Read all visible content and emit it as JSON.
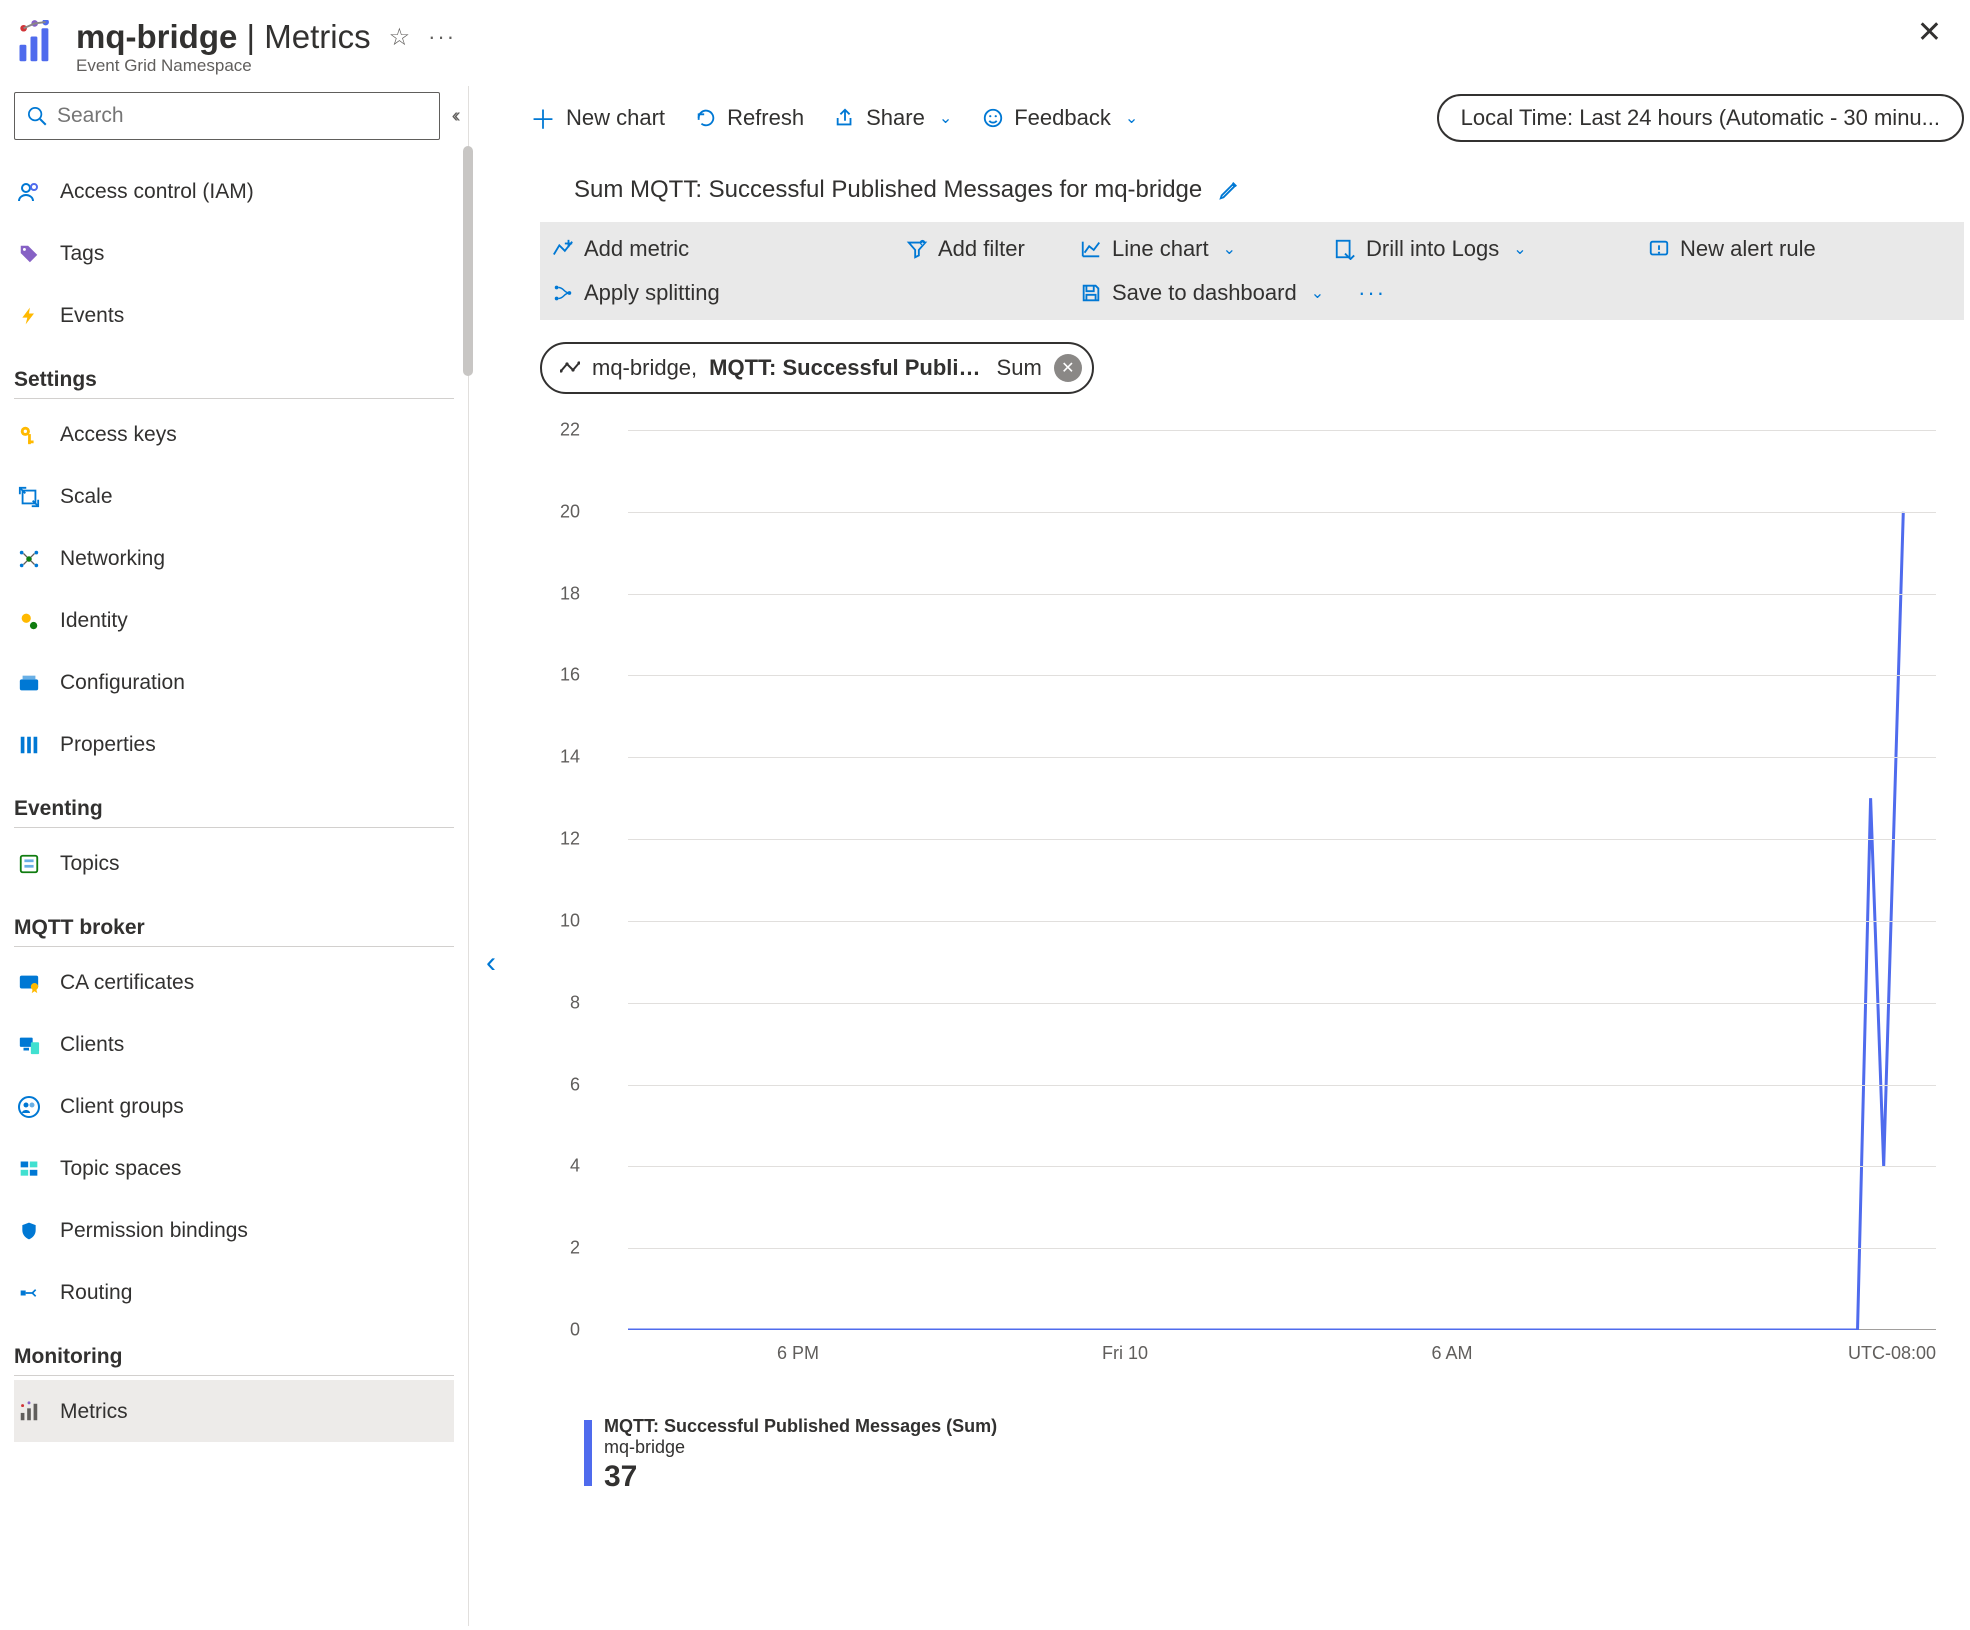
{
  "header": {
    "resource_name": "mq-bridge",
    "section": "Metrics",
    "subtitle": "Event Grid Namespace"
  },
  "sidebar": {
    "search_placeholder": "Search",
    "items_top": [
      {
        "icon": "people",
        "label": "Access control (IAM)"
      },
      {
        "icon": "tag",
        "label": "Tags"
      },
      {
        "icon": "bolt",
        "label": "Events"
      }
    ],
    "sections": [
      {
        "title": "Settings",
        "items": [
          {
            "icon": "key",
            "label": "Access keys"
          },
          {
            "icon": "scale",
            "label": "Scale"
          },
          {
            "icon": "network",
            "label": "Networking"
          },
          {
            "icon": "identity",
            "label": "Identity"
          },
          {
            "icon": "config",
            "label": "Configuration"
          },
          {
            "icon": "properties",
            "label": "Properties"
          }
        ]
      },
      {
        "title": "Eventing",
        "items": [
          {
            "icon": "topics",
            "label": "Topics"
          }
        ]
      },
      {
        "title": "MQTT broker",
        "items": [
          {
            "icon": "cert",
            "label": "CA certificates"
          },
          {
            "icon": "clients",
            "label": "Clients"
          },
          {
            "icon": "group",
            "label": "Client groups"
          },
          {
            "icon": "topicspace",
            "label": "Topic spaces"
          },
          {
            "icon": "shield",
            "label": "Permission bindings"
          },
          {
            "icon": "routing",
            "label": "Routing"
          }
        ]
      },
      {
        "title": "Monitoring",
        "items": [
          {
            "icon": "metrics",
            "label": "Metrics",
            "selected": true
          }
        ]
      }
    ]
  },
  "toolbar": {
    "new_chart": "New chart",
    "refresh": "Refresh",
    "share": "Share",
    "feedback": "Feedback",
    "time_range": "Local Time: Last 24 hours (Automatic - 30 minu..."
  },
  "chart": {
    "title": "Sum MQTT: Successful Published Messages for mq-bridge",
    "toolbar": {
      "add_metric": "Add metric",
      "add_filter": "Add filter",
      "line_chart": "Line chart",
      "drill_logs": "Drill into Logs",
      "new_alert": "New alert rule",
      "apply_split": "Apply splitting",
      "save_dash": "Save to dashboard"
    },
    "metric_pill": {
      "scope": "mq-bridge, ",
      "metric": "MQTT: Successful Publi…",
      "aggregation": "Sum"
    },
    "legend": {
      "name": "MQTT: Successful Published Messages (Sum)",
      "resource": "mq-bridge",
      "value": "37"
    },
    "y_ticks": [
      0,
      2,
      4,
      6,
      8,
      10,
      12,
      14,
      16,
      18,
      20,
      22
    ],
    "x_ticks": [
      {
        "pos": 0.13,
        "label": "6 PM"
      },
      {
        "pos": 0.38,
        "label": "Fri 10"
      },
      {
        "pos": 0.63,
        "label": "6 AM"
      }
    ],
    "tz": "UTC-08:00"
  },
  "chart_data": {
    "type": "line",
    "title": "Sum MQTT: Successful Published Messages for mq-bridge",
    "ylabel": "",
    "xlabel": "",
    "ylim": [
      0,
      22
    ],
    "tz": "UTC-08:00",
    "series": [
      {
        "name": "MQTT: Successful Published Messages (Sum)",
        "resource": "mq-bridge",
        "total": 37,
        "points": [
          {
            "x": 0.0,
            "y": 0
          },
          {
            "x": 0.94,
            "y": 0
          },
          {
            "x": 0.95,
            "y": 13
          },
          {
            "x": 0.96,
            "y": 4
          },
          {
            "x": 0.975,
            "y": 20
          }
        ]
      }
    ]
  }
}
